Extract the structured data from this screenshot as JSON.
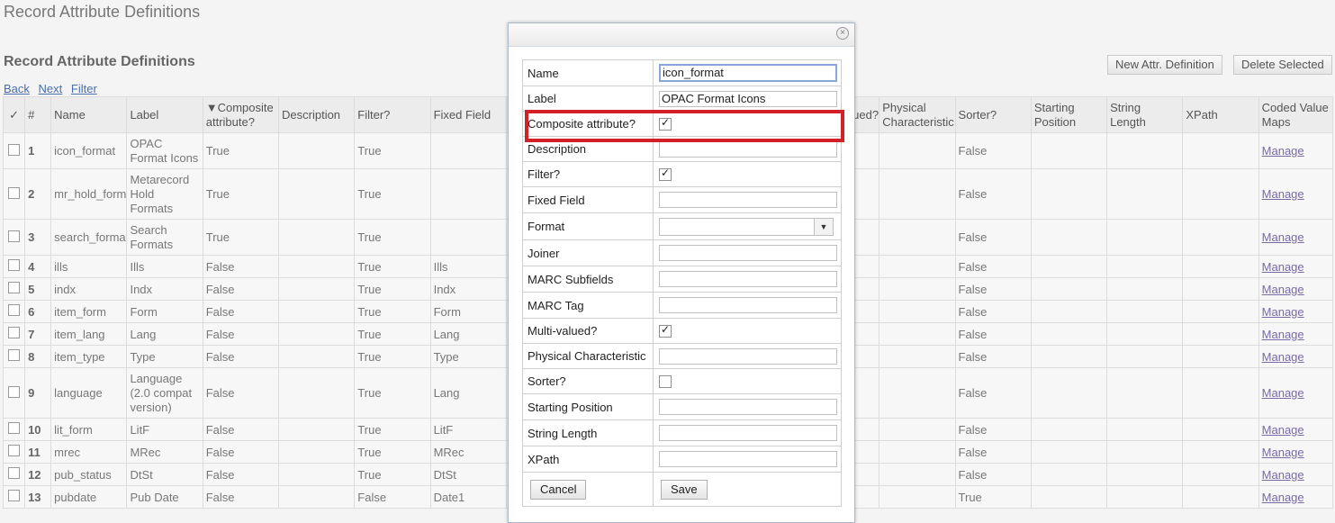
{
  "page": {
    "title": "Record Attribute Definitions",
    "section_title": "Record Attribute Definitions"
  },
  "nav": {
    "back": "Back",
    "next": "Next",
    "filter": "Filter"
  },
  "toolbar": {
    "new_label": "New Attr. Definition",
    "delete_label": "Delete Selected"
  },
  "grid": {
    "headers": {
      "check": "✓",
      "num": "#",
      "name": "Name",
      "label": "Label",
      "composite": "▼Composite attribute?",
      "description": "Description",
      "filter": "Filter?",
      "fixed_field": "Fixed Field",
      "multi": "ued?",
      "physical": "Physical Characteristic",
      "sorter": "Sorter?",
      "starting": "Starting Position",
      "string_length": "String Length",
      "xpath": "XPath",
      "coded": "Coded Value Maps"
    },
    "rows": [
      {
        "num": "1",
        "name": "icon_format",
        "label": "OPAC Format Icons",
        "composite": "True",
        "filter": "True",
        "fixed": "",
        "sorter": "False",
        "link": "Manage"
      },
      {
        "num": "2",
        "name": "mr_hold_format",
        "label": "Metarecord Hold Formats",
        "composite": "True",
        "filter": "True",
        "fixed": "",
        "sorter": "False",
        "link": "Manage"
      },
      {
        "num": "3",
        "name": "search_format",
        "label": "Search Formats",
        "composite": "True",
        "filter": "True",
        "fixed": "",
        "sorter": "False",
        "link": "Manage"
      },
      {
        "num": "4",
        "name": "ills",
        "label": "Ills",
        "composite": "False",
        "filter": "True",
        "fixed": "Ills",
        "sorter": "False",
        "link": "Manage"
      },
      {
        "num": "5",
        "name": "indx",
        "label": "Indx",
        "composite": "False",
        "filter": "True",
        "fixed": "Indx",
        "sorter": "False",
        "link": "Manage"
      },
      {
        "num": "6",
        "name": "item_form",
        "label": "Form",
        "composite": "False",
        "filter": "True",
        "fixed": "Form",
        "sorter": "False",
        "link": "Manage"
      },
      {
        "num": "7",
        "name": "item_lang",
        "label": "Lang",
        "composite": "False",
        "filter": "True",
        "fixed": "Lang",
        "sorter": "False",
        "link": "Manage"
      },
      {
        "num": "8",
        "name": "item_type",
        "label": "Type",
        "composite": "False",
        "filter": "True",
        "fixed": "Type",
        "sorter": "False",
        "link": "Manage"
      },
      {
        "num": "9",
        "name": "language",
        "label": "Language (2.0 compat version)",
        "composite": "False",
        "filter": "True",
        "fixed": "Lang",
        "sorter": "False",
        "link": "Manage"
      },
      {
        "num": "10",
        "name": "lit_form",
        "label": "LitF",
        "composite": "False",
        "filter": "True",
        "fixed": "LitF",
        "sorter": "False",
        "link": "Manage"
      },
      {
        "num": "11",
        "name": "mrec",
        "label": "MRec",
        "composite": "False",
        "filter": "True",
        "fixed": "MRec",
        "sorter": "False",
        "link": "Manage"
      },
      {
        "num": "12",
        "name": "pub_status",
        "label": "DtSt",
        "composite": "False",
        "filter": "True",
        "fixed": "DtSt",
        "sorter": "False",
        "link": "Manage"
      },
      {
        "num": "13",
        "name": "pubdate",
        "label": "Pub Date",
        "composite": "False",
        "filter": "False",
        "fixed": "Date1",
        "sorter": "True",
        "link": "Manage"
      }
    ]
  },
  "dialog": {
    "close_icon": "close-icon",
    "fields": {
      "name": {
        "label": "Name",
        "value": "icon_format"
      },
      "label": {
        "label": "Label",
        "value": "OPAC Format Icons"
      },
      "composite": {
        "label": "Composite attribute?",
        "checked": true
      },
      "description": {
        "label": "Description",
        "value": ""
      },
      "filter": {
        "label": "Filter?",
        "checked": true
      },
      "fixed_field": {
        "label": "Fixed Field",
        "value": ""
      },
      "format": {
        "label": "Format",
        "value": ""
      },
      "joiner": {
        "label": "Joiner",
        "value": ""
      },
      "marc_subfields": {
        "label": "MARC Subfields",
        "value": ""
      },
      "marc_tag": {
        "label": "MARC Tag",
        "value": ""
      },
      "multi_valued": {
        "label": "Multi-valued?",
        "checked": true
      },
      "physical": {
        "label": "Physical Characteristic",
        "value": ""
      },
      "sorter": {
        "label": "Sorter?",
        "checked": false
      },
      "starting_position": {
        "label": "Starting Position",
        "value": ""
      },
      "string_length": {
        "label": "String Length",
        "value": ""
      },
      "xpath": {
        "label": "XPath",
        "value": ""
      }
    },
    "cancel_label": "Cancel",
    "save_label": "Save",
    "check_glyph": "✓"
  },
  "colors": {
    "highlight": "#d42127",
    "link": "#4a6ea9"
  }
}
